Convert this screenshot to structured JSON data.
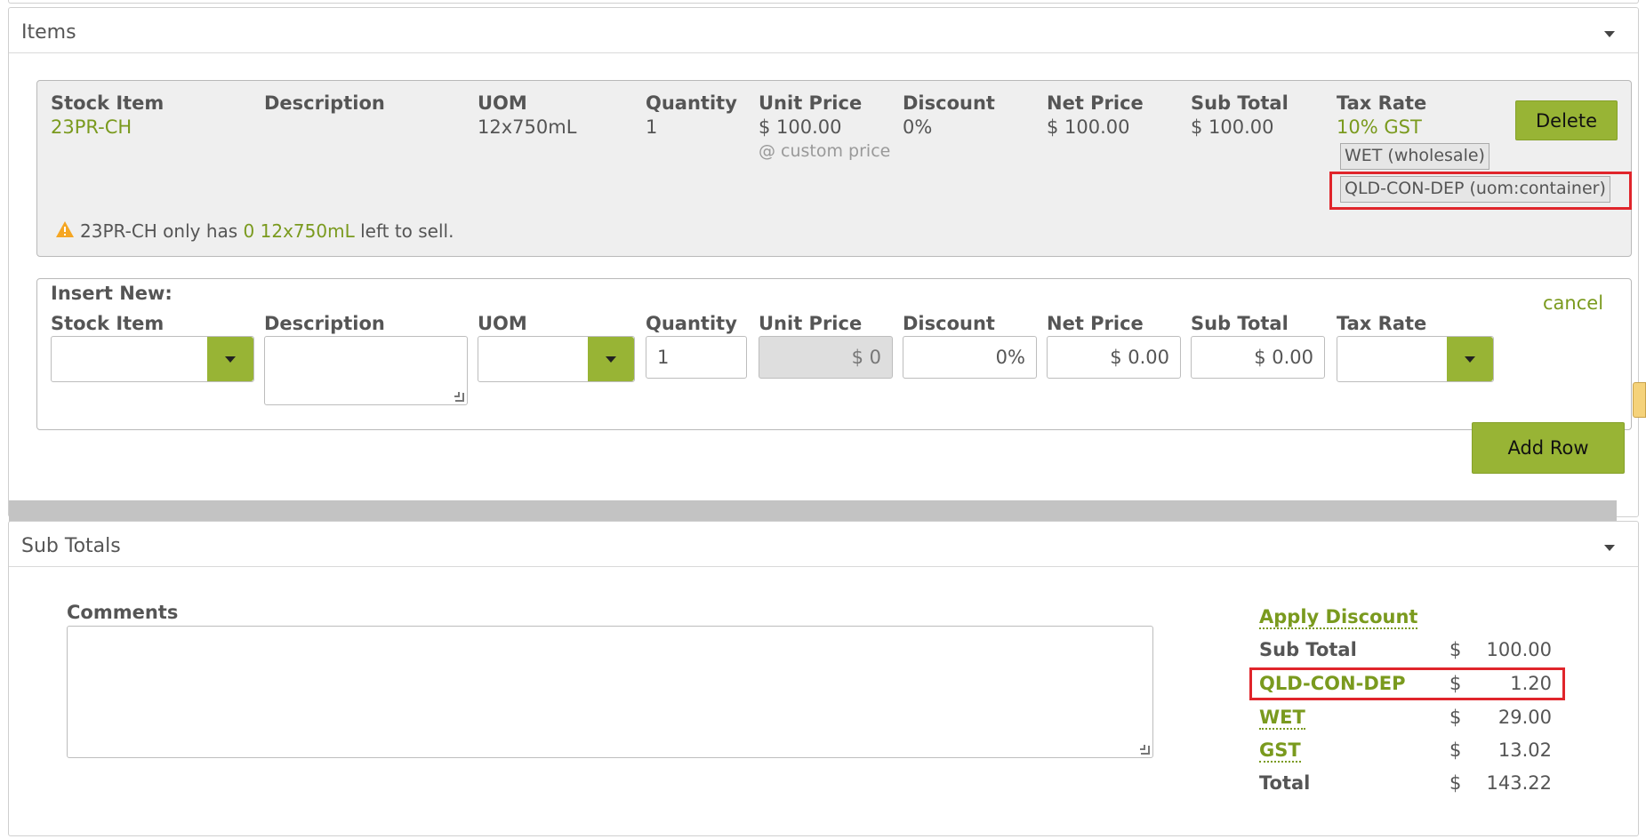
{
  "items_panel": {
    "title": "Items",
    "columns": [
      "Stock Item",
      "Description",
      "UOM",
      "Quantity",
      "Unit Price",
      "Discount",
      "Net Price",
      "Sub Total",
      "Tax Rate"
    ],
    "row": {
      "stock_item": "23PR-CH",
      "description": "",
      "uom": "12x750mL",
      "quantity": "1",
      "unit_price": "$ 100.00",
      "price_note": "@ custom price",
      "discount": "0%",
      "net_price": "$ 100.00",
      "sub_total": "$ 100.00",
      "tax_primary": "10% GST",
      "tax_tags": [
        "WET (wholesale)",
        "QLD-CON-DEP (uom:container)"
      ],
      "delete_label": "Delete",
      "warning": {
        "prefix": "23PR-CH only has",
        "highlight": "0 12x750mL",
        "suffix": "left to sell."
      }
    },
    "insert": {
      "title": "Insert New:",
      "cancel_label": "cancel",
      "quantity_value": "1",
      "unit_price_value": "$ 0",
      "discount_value": "0%",
      "net_price_value": "$ 0.00",
      "sub_total_value": "$ 0.00",
      "add_row_label": "Add Row"
    }
  },
  "subtotals_panel": {
    "title": "Sub Totals",
    "comments_label": "Comments",
    "apply_discount_label": "Apply Discount",
    "currency_symbol": "$",
    "rows": [
      {
        "label": "Sub Total",
        "amount": "100.00"
      },
      {
        "label": "QLD-CON-DEP",
        "amount": "1.20"
      },
      {
        "label": "WET",
        "amount": "29.00"
      },
      {
        "label": "GST",
        "amount": "13.02"
      },
      {
        "label": "Total",
        "amount": "143.22"
      }
    ]
  },
  "colors": {
    "accent_green": "#98b435",
    "link_green": "#7a9a1e",
    "highlight_red": "#e0252b"
  }
}
